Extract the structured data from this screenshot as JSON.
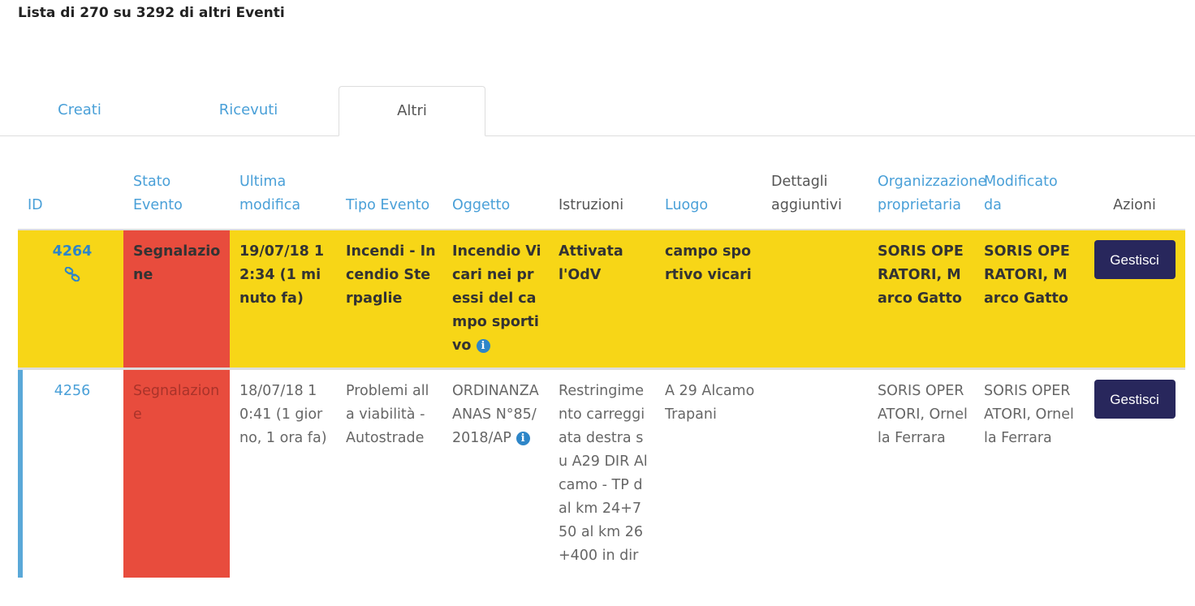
{
  "heading": "Lista di 270 su 3292 di altri Eventi",
  "tabs": [
    {
      "label": "Creati"
    },
    {
      "label": "Ricevuti"
    },
    {
      "label": "Altri"
    }
  ],
  "active_tab": "Altri",
  "columns": {
    "id": "ID",
    "stato": "Stato Evento",
    "ultima_modifica": "Ultima modifica",
    "tipo": "Tipo Evento",
    "oggetto": "Oggetto",
    "istruzioni": "Istruzioni",
    "luogo": "Luogo",
    "dettagli": "Dettagli aggiuntivi",
    "organizzazione": "Organizzazione proprietaria",
    "modificato_da": "Modificato da",
    "azioni": "Azioni"
  },
  "rows": [
    {
      "id": "4264",
      "stato": "Segnalazione",
      "ultima_modifica": "19/07/18 12:34 (1 minuto fa)",
      "tipo": "Incendi - Incendio Sterpaglie",
      "oggetto": "Incendio Vicari nei pressi del campo sportivo",
      "istruzioni": "Attivata l'OdV",
      "luogo": "campo sportivo vicari",
      "dettagli": "",
      "organizzazione": "SORIS OPERATORI, Marco Gatto",
      "modificato_da": "SORIS OPERATORI, Marco Gatto",
      "action_label": "Gestisci"
    },
    {
      "id": "4256",
      "stato": "Segnalazione",
      "ultima_modifica": "18/07/18 10:41 (1 giorno, 1 ora fa)",
      "tipo": "Problemi alla viabilità - Autostrade",
      "oggetto": "ORDINANZA ANAS N°85/2018/AP",
      "istruzioni": "Restringimento carreggiata destra su A29 DIR Alcamo - TP dal km 24+750 al km 26+400 in dir",
      "luogo": "A 29 Alcamo Trapani",
      "dettagli": "",
      "organizzazione": "SORIS OPERATORI, Ornella Ferrara",
      "modificato_da": "SORIS OPERATORI, Ornella Ferrara",
      "action_label": "Gestisci"
    }
  ],
  "icons": {
    "chain": "link-chain-icon",
    "info": "info-circle-icon",
    "info_glyph": "i"
  },
  "colors": {
    "highlight_row": "#f7d617",
    "state_red": "#e84c3d",
    "link_blue": "#4aa0d8",
    "button_navy": "#28275c",
    "row_marker": "#5aa8d8"
  }
}
